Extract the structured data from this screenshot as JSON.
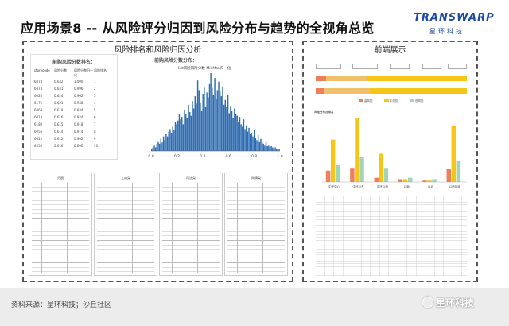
{
  "slide": {
    "title": "应用场景8 -- 从风险评分归因到风险分布与趋势的全视角总览",
    "logo_text": "TRANSWARP",
    "logo_cn": "星环科技"
  },
  "left_panel": {
    "title": "风险排名和风险归因分析",
    "rank_table": {
      "heading": "前购风险分数排名：",
      "columns": [
        "storecode",
        "风险分数",
        "风险分数归一化",
        "风险排名"
      ],
      "rows": [
        [
          "6878",
          "0.632",
          "1.000",
          "1"
        ],
        [
          "6873",
          "0.631",
          "0.996",
          "2"
        ],
        [
          "6026",
          "0.624",
          "0.962",
          "3"
        ],
        [
          "6175",
          "0.621",
          "0.948",
          "4"
        ],
        [
          "6868",
          "0.618",
          "0.934",
          "5"
        ],
        [
          "6018",
          "0.616",
          "0.924",
          "6"
        ],
        [
          "6180",
          "0.615",
          "0.918",
          "7"
        ],
        [
          "6056",
          "0.614",
          "0.914",
          "8"
        ],
        [
          "6012",
          "0.612",
          "0.902",
          "9"
        ],
        [
          "6032",
          "0.610",
          "0.895",
          "10"
        ]
      ]
    },
    "histogram": {
      "heading": "前购风险分数分布：",
      "subtitle": "Hist风险风险分数-MinMax归一化"
    },
    "doc_headers": [
      "归因",
      "工商类",
      "司法类",
      "舆情类"
    ]
  },
  "right_panel": {
    "title": "前端展示",
    "legend": [
      "高风险",
      "中风险",
      "低风险"
    ],
    "bar_chart_title": "风险分布及排名",
    "bar_rows": [
      {
        "segments": [
          0.07,
          0.27,
          0.66
        ]
      },
      {
        "segments": [
          0.06,
          0.3,
          0.64
        ]
      }
    ],
    "group_colors": {
      "red": "#ef7f5a",
      "yellow": "#f5c518",
      "green": "#9fd7b6"
    }
  },
  "chart_data": {
    "type": "bar",
    "title": "Hist风险风险分数-MinMax归一化",
    "x": [
      0.01,
      0.02,
      0.03,
      0.04,
      0.05,
      0.06,
      0.07,
      0.08,
      0.09,
      0.1,
      0.11,
      0.12,
      0.13,
      0.14,
      0.15,
      0.16,
      0.17,
      0.18,
      0.19,
      0.2,
      0.21,
      0.22,
      0.23,
      0.24,
      0.25,
      0.26,
      0.27,
      0.28,
      0.29,
      0.3,
      0.31,
      0.32,
      0.33,
      0.34,
      0.35,
      0.36,
      0.37,
      0.38,
      0.39,
      0.4,
      0.41,
      0.42,
      0.43,
      0.44,
      0.45,
      0.46,
      0.47,
      0.48,
      0.49,
      0.5,
      0.51,
      0.52,
      0.53,
      0.54,
      0.55,
      0.56,
      0.57,
      0.58,
      0.59,
      0.6,
      0.61,
      0.62,
      0.63,
      0.64,
      0.65,
      0.66,
      0.67,
      0.68,
      0.69,
      0.7,
      0.71,
      0.72,
      0.73,
      0.74,
      0.75,
      0.76,
      0.77,
      0.78,
      0.79,
      0.8,
      0.81,
      0.82,
      0.83,
      0.84,
      0.85,
      0.86,
      0.87,
      0.88,
      0.89,
      0.9,
      0.91,
      0.92,
      0.93,
      0.94,
      0.95,
      0.96,
      0.97,
      0.98
    ],
    "values": [
      2,
      3,
      5,
      3,
      6,
      8,
      6,
      10,
      7,
      12,
      9,
      14,
      12,
      16,
      18,
      15,
      20,
      17,
      24,
      22,
      25,
      30,
      26,
      28,
      22,
      34,
      30,
      27,
      38,
      32,
      29,
      41,
      35,
      45,
      39,
      58,
      50,
      40,
      33,
      47,
      52,
      36,
      48,
      44,
      55,
      64,
      52,
      46,
      60,
      43,
      50,
      57,
      49,
      45,
      53,
      38,
      42,
      36,
      46,
      31,
      37,
      33,
      27,
      35,
      30,
      29,
      24,
      28,
      22,
      20,
      26,
      18,
      21,
      16,
      19,
      14,
      15,
      12,
      17,
      11,
      9,
      13,
      8,
      10,
      7,
      6,
      5,
      8,
      4,
      5,
      3,
      4,
      3,
      2,
      3,
      2,
      1,
      2
    ],
    "xlim": [
      0.0,
      1.0
    ],
    "xticks": [
      "0.0",
      "0.2",
      "0.4",
      "0.6",
      "0.8",
      "1.0"
    ]
  },
  "right_chart_data": {
    "type": "bar",
    "categories": [
      "中环中心",
      "中环以东",
      "中环以西",
      "以南",
      "以北",
      "以西区域"
    ],
    "series": [
      {
        "values": [
          8,
          10,
          3,
          2,
          1,
          9
        ]
      },
      {
        "values": [
          30,
          45,
          20,
          2,
          1,
          40
        ]
      },
      {
        "values": [
          12,
          18,
          10,
          3,
          2,
          15
        ]
      }
    ]
  },
  "footer": {
    "source": "资料来源：星环科技；沙丘社区",
    "watermark": "星环科技"
  }
}
